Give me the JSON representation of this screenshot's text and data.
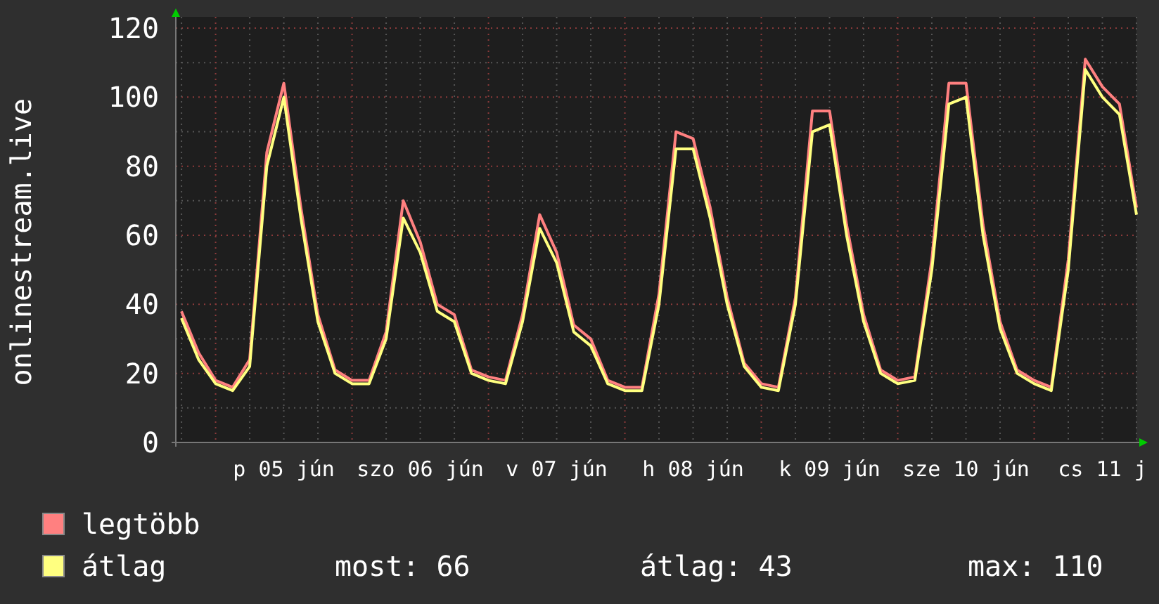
{
  "chart": {
    "chart_data": {
      "type": "line",
      "grid": true,
      "ylabel": "onlinestream.live",
      "ylim": [
        0,
        120
      ],
      "yticks": [
        0,
        20,
        40,
        60,
        80,
        100,
        120
      ],
      "categories": [
        null,
        null,
        null,
        null,
        null,
        null,
        "p 05 jún",
        null,
        null,
        null,
        null,
        null,
        null,
        null,
        "szo 06 jún",
        null,
        null,
        null,
        null,
        null,
        null,
        null,
        "v 07 jún",
        null,
        null,
        null,
        null,
        null,
        null,
        null,
        "h 08 jún",
        null,
        null,
        null,
        null,
        null,
        null,
        null,
        "k 09 jún",
        null,
        null,
        null,
        null,
        null,
        null,
        null,
        "sze 10 jún",
        null,
        null,
        null,
        null,
        null,
        null,
        null,
        "cs 11 j",
        null,
        null
      ],
      "series": [
        {
          "name": "legtöbb",
          "color": "#ff8080",
          "values": [
            38,
            26,
            18,
            16,
            24,
            84,
            104,
            68,
            37,
            21,
            18,
            18,
            32,
            70,
            58,
            40,
            37,
            21,
            19,
            18,
            37,
            66,
            55,
            34,
            30,
            18,
            16,
            16,
            43,
            90,
            88,
            68,
            42,
            23,
            17,
            16,
            42,
            96,
            96,
            63,
            37,
            21,
            18,
            19,
            53,
            104,
            104,
            63,
            35,
            21,
            18,
            16,
            53,
            111,
            103,
            98,
            68
          ]
        },
        {
          "name": "átlag",
          "color": "#ffff80",
          "values": [
            36,
            24,
            17,
            15,
            22,
            80,
            100,
            65,
            35,
            20,
            17,
            17,
            30,
            65,
            55,
            38,
            35,
            20,
            18,
            17,
            35,
            62,
            52,
            32,
            28,
            17,
            15,
            15,
            40,
            85,
            85,
            65,
            40,
            22,
            16,
            15,
            40,
            90,
            92,
            60,
            35,
            20,
            17,
            18,
            50,
            98,
            100,
            60,
            33,
            20,
            17,
            15,
            50,
            108,
            100,
            95,
            66
          ]
        }
      ]
    }
  },
  "stats": [
    "most: 66",
    "átlag: 43",
    "max: 110"
  ]
}
